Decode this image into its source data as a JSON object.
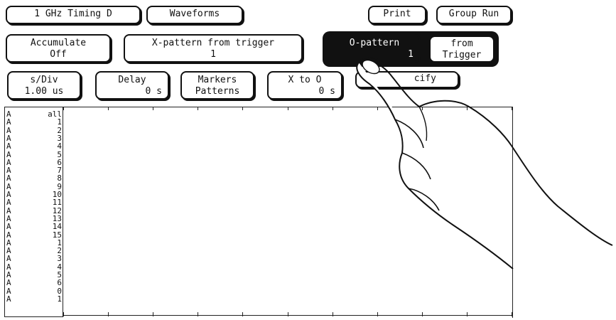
{
  "top_menu": {
    "timing_label": "1 GHz Timing D",
    "waveforms_label": "Waveforms",
    "print_label": "Print",
    "group_run_label": "Group Run"
  },
  "controls": {
    "accumulate": {
      "label": "Accumulate",
      "value": "Off"
    },
    "x_pattern": {
      "label": "X-pattern from trigger",
      "value": "1"
    },
    "o_pattern": {
      "label": "O-pattern",
      "value": "1"
    },
    "from_trigger": {
      "line1": "from",
      "line2": "Trigger"
    },
    "sdiv": {
      "label": "s/Div",
      "value": "1.00 us"
    },
    "delay": {
      "label": "Delay",
      "value": "0 s"
    },
    "markers": {
      "label": "Markers",
      "value": "Patterns"
    },
    "x_to_o": {
      "label": "X to O",
      "value": "0 s"
    },
    "specify_partial": "cify"
  },
  "labels": [
    {
      "pod": "A",
      "bit": "all"
    },
    {
      "pod": "A",
      "bit": "1"
    },
    {
      "pod": "A",
      "bit": "2"
    },
    {
      "pod": "A",
      "bit": "3"
    },
    {
      "pod": "A",
      "bit": "4"
    },
    {
      "pod": "A",
      "bit": "5"
    },
    {
      "pod": "A",
      "bit": "6"
    },
    {
      "pod": "A",
      "bit": "7"
    },
    {
      "pod": "A",
      "bit": "8"
    },
    {
      "pod": "A",
      "bit": "9"
    },
    {
      "pod": "A",
      "bit": "10"
    },
    {
      "pod": "A",
      "bit": "11"
    },
    {
      "pod": "A",
      "bit": "12"
    },
    {
      "pod": "A",
      "bit": "13"
    },
    {
      "pod": "A",
      "bit": "14"
    },
    {
      "pod": "A",
      "bit": "15"
    },
    {
      "pod": "A",
      "bit": "1"
    },
    {
      "pod": "A",
      "bit": "2"
    },
    {
      "pod": "A",
      "bit": "3"
    },
    {
      "pod": "A",
      "bit": "4"
    },
    {
      "pod": "A",
      "bit": "5"
    },
    {
      "pod": "A",
      "bit": "6"
    },
    {
      "pod": "A",
      "bit": "0"
    },
    {
      "pod": "A",
      "bit": "1"
    }
  ]
}
